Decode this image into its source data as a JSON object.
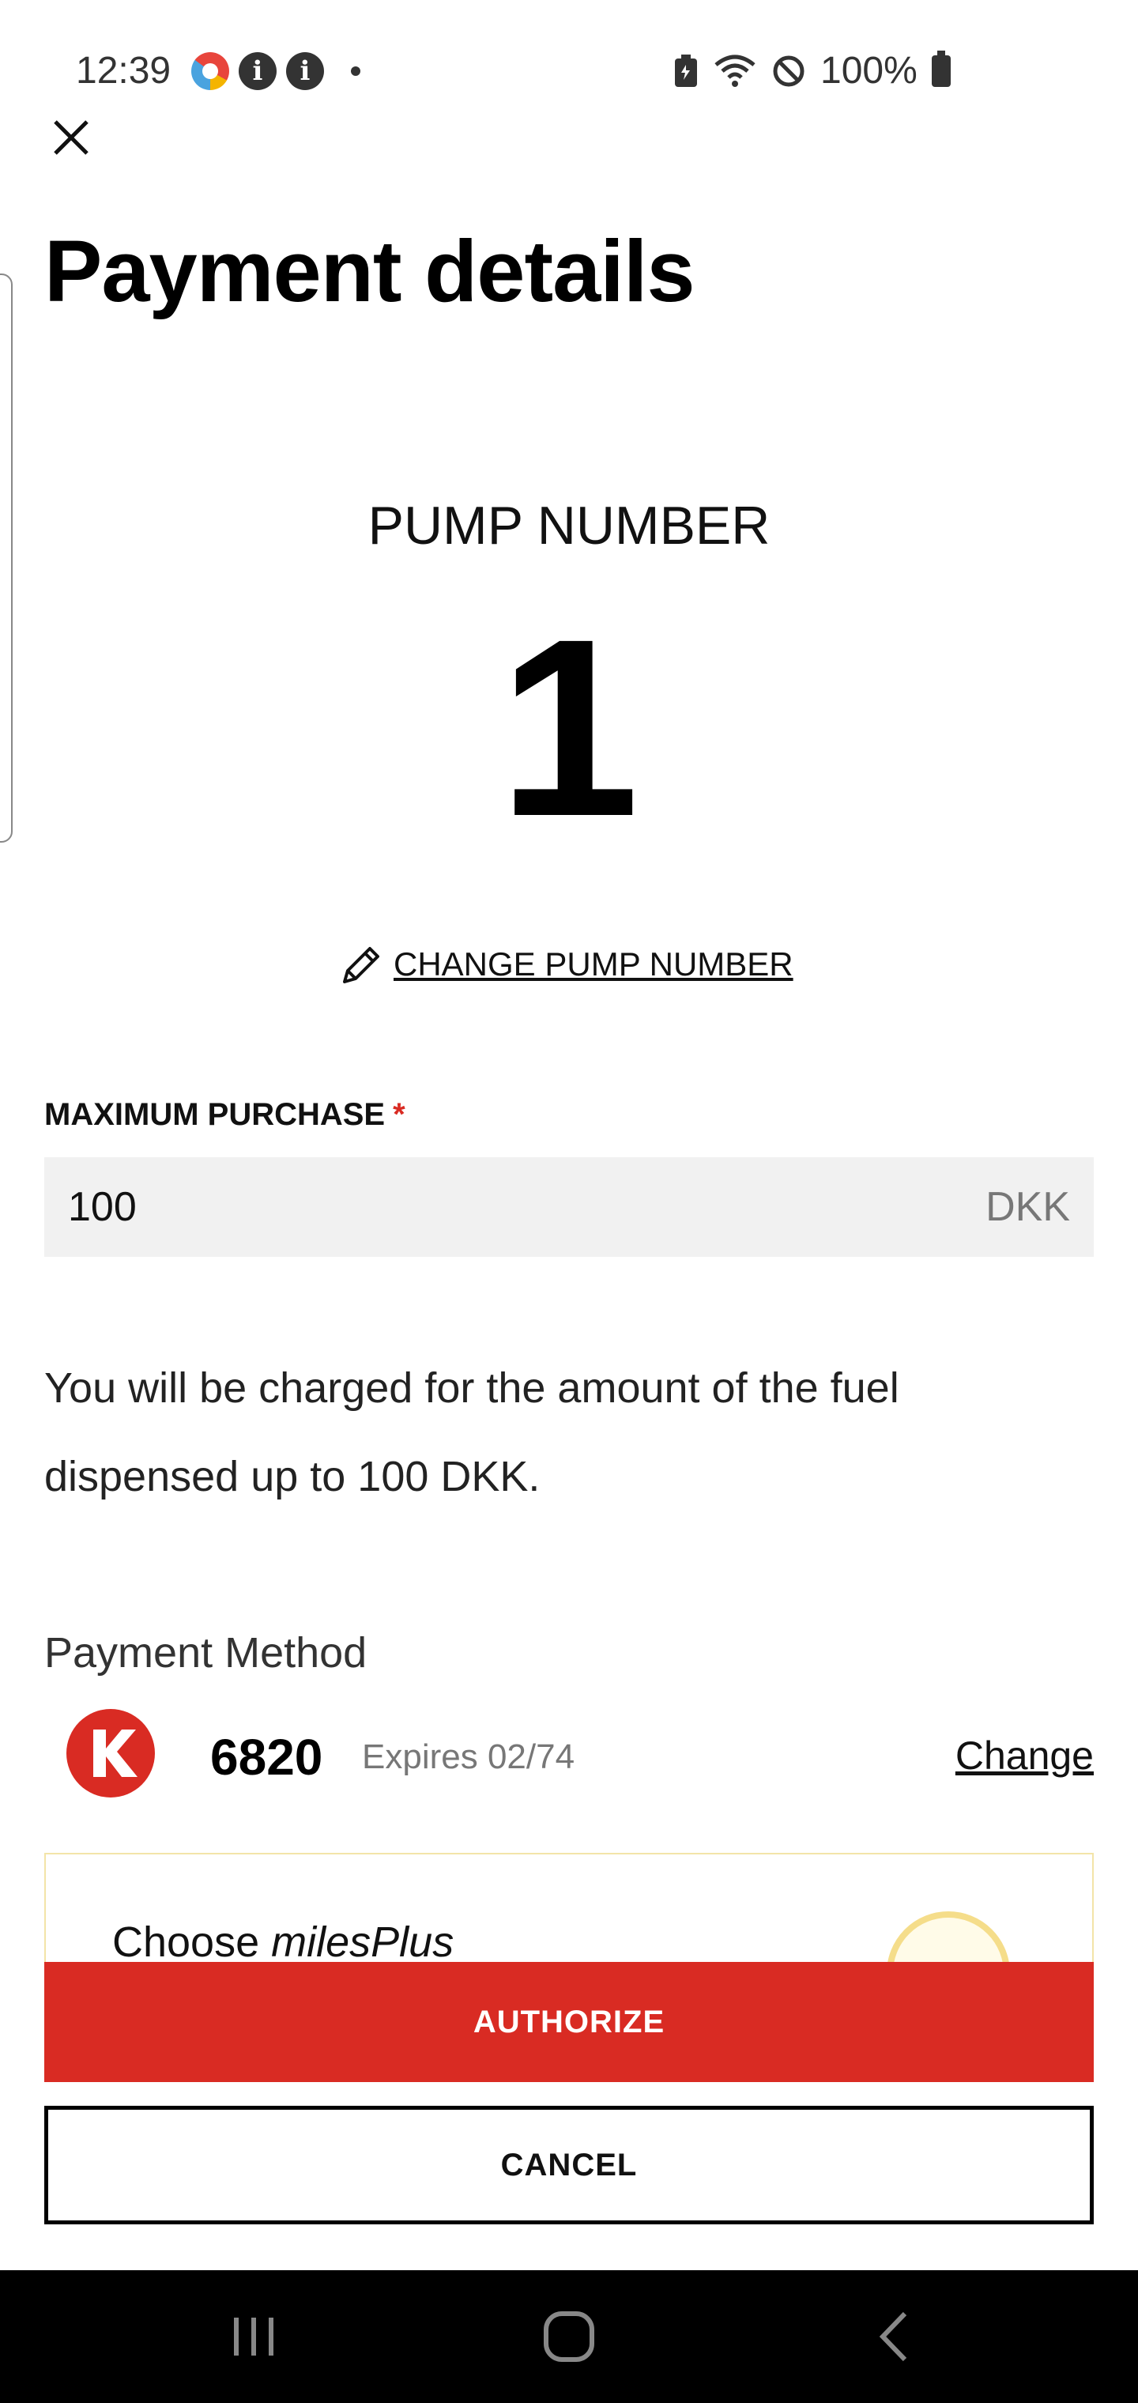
{
  "status_bar": {
    "time": "12:39",
    "battery": "100%",
    "icons": [
      "app-notification-icon",
      "info-icon",
      "info-icon",
      "dot-icon",
      "battery-saver-icon",
      "wifi-icon",
      "do-not-disturb-icon",
      "battery-icon"
    ]
  },
  "header": {
    "close_icon": "close-icon",
    "title": "Payment details"
  },
  "pump": {
    "label": "PUMP NUMBER",
    "number": "1",
    "change_label": "CHANGE PUMP NUMBER",
    "change_icon": "pencil-icon"
  },
  "max_purchase": {
    "label": "MAXIMUM PURCHASE",
    "required_mark": "*",
    "value": "100",
    "unit": "DKK"
  },
  "charge_notice": {
    "line1": "You will be charged for the amount of the fuel",
    "line2": "dispensed up to 100 DKK."
  },
  "payment_method": {
    "title": "Payment Method",
    "card_logo_letter": "K",
    "card_number": "6820",
    "expires": "Expires 02/74",
    "change_label": "Change"
  },
  "miles": {
    "prefix": "Choose ",
    "brand": "milesPlus"
  },
  "actions": {
    "authorize": "AUTHORIZE",
    "cancel": "CANCEL"
  },
  "nav_bar": {
    "recents_icon": "recents-icon",
    "home_icon": "home-icon",
    "back_icon": "back-icon"
  },
  "colors": {
    "accent": "#d92b23",
    "field_bg": "#f1f1f1",
    "nav_bg": "#000000"
  }
}
